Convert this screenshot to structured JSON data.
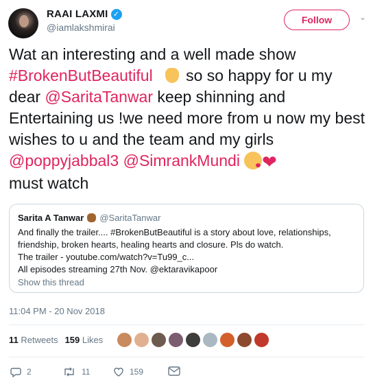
{
  "user": {
    "display_name": "RAAI LAXMI",
    "handle": "@iamlakshmirai",
    "verified": true
  },
  "follow_button": {
    "label": "Follow"
  },
  "tweet": {
    "part1": "Wat an interesting and a well made show ",
    "hashtag": "#BrokenButBeautiful",
    "part2": " so so happy for u my dear ",
    "mention1": "@SaritaTanwar",
    "part3": " keep shinning and Entertaining us !we need more from u now my best wishes to u and the team and my girls ",
    "mention2": "@poppyjabbal3",
    "space": " ",
    "mention3": "@SimrankMundi",
    "part4": "must watch"
  },
  "quoted": {
    "name": "Sarita A Tanwar",
    "handle": "@SaritaTanwar",
    "line1": "And finally the trailer.... #BrokenButBeautiful is a story about love, relationships,",
    "line2": "friendship, broken hearts, healing hearts and closure. Pls do watch.",
    "line3": "The trailer - youtube.com/watch?v=Tu99_c...",
    "line4": "All episodes streaming 27th Nov. @ektaravikapoor",
    "show_thread": "Show this thread"
  },
  "timestamp": "11:04 PM - 20 Nov 2018",
  "stats": {
    "retweets_count": "11",
    "retweets_label": "Retweets",
    "likes_count": "159",
    "likes_label": "Likes"
  },
  "actions": {
    "reply_count": "2",
    "retweet_count": "11",
    "like_count": "159"
  },
  "colors": {
    "accent": "#e0245e",
    "verified": "#1da1f2",
    "muted": "#657786"
  }
}
